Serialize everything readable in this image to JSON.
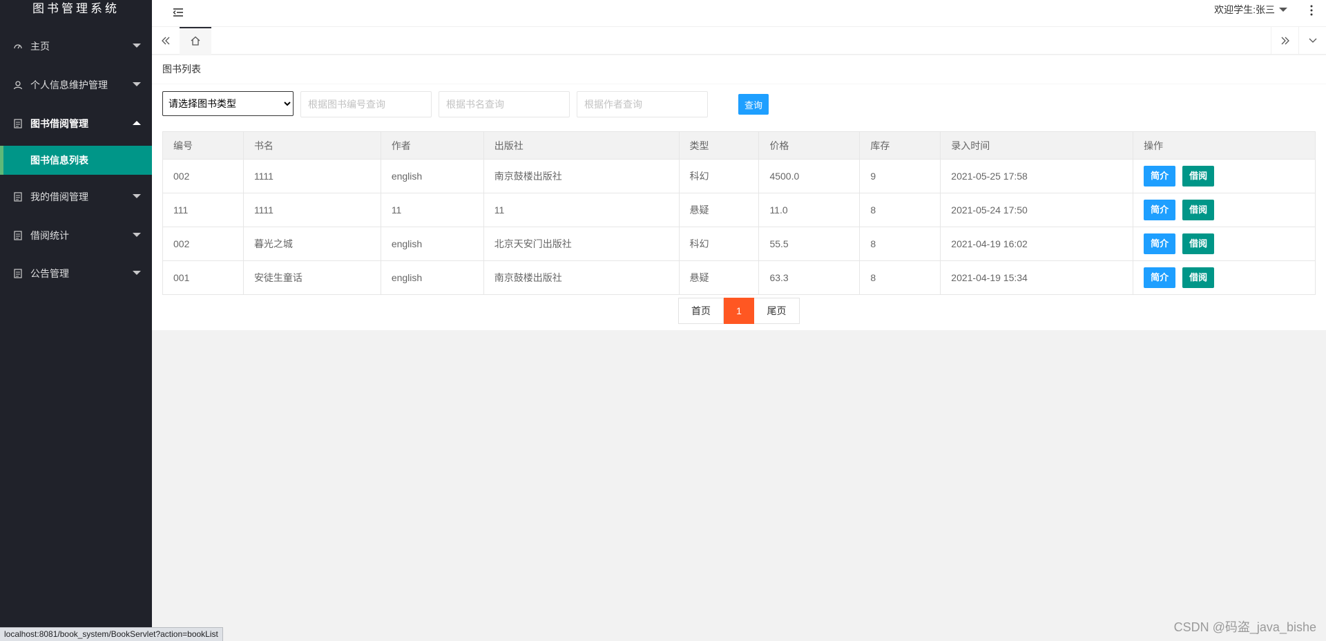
{
  "app": {
    "title": "图书管理系统"
  },
  "sidebar": {
    "items": [
      {
        "label": "主页",
        "icon": "dashboard-icon"
      },
      {
        "label": "个人信息维护管理",
        "icon": "user-icon"
      },
      {
        "label": "图书借阅管理",
        "icon": "document-icon",
        "expanded": true
      },
      {
        "label": "我的借阅管理",
        "icon": "document-icon"
      },
      {
        "label": "借阅统计",
        "icon": "document-icon"
      },
      {
        "label": "公告管理",
        "icon": "document-icon"
      }
    ],
    "subitem": {
      "label": "图书信息列表"
    }
  },
  "header": {
    "user": "欢迎学生:张三"
  },
  "card": {
    "title": "图书列表"
  },
  "filters": {
    "type_select": "请选择图书类型",
    "id_placeholder": "根据图书编号查询",
    "name_placeholder": "根据书名查询",
    "author_placeholder": "根据作者查询",
    "query_label": "查询"
  },
  "table": {
    "columns": [
      "编号",
      "书名",
      "作者",
      "出版社",
      "类型",
      "价格",
      "库存",
      "录入时间",
      "操作"
    ],
    "rows": [
      {
        "id": "002",
        "name": "1111",
        "author": "english",
        "publisher": "南京鼓楼出版社",
        "type": "科幻",
        "price": "4500.0",
        "stock": "9",
        "time": "2021-05-25 17:58"
      },
      {
        "id": "111",
        "name": "1111",
        "author": "11",
        "publisher": "11",
        "type": "悬疑",
        "price": "11.0",
        "stock": "8",
        "time": "2021-05-24 17:50"
      },
      {
        "id": "002",
        "name": "暮光之城",
        "author": "english",
        "publisher": "北京天安门出版社",
        "type": "科幻",
        "price": "55.5",
        "stock": "8",
        "time": "2021-04-19 16:02"
      },
      {
        "id": "001",
        "name": "安徒生童话",
        "author": "english",
        "publisher": "南京鼓楼出版社",
        "type": "悬疑",
        "price": "63.3",
        "stock": "8",
        "time": "2021-04-19 15:34"
      }
    ],
    "intro_label": "简介",
    "borrow_label": "借阅"
  },
  "pager": {
    "first": "首页",
    "current": "1",
    "last": "尾页"
  },
  "statusbar": {
    "url": "localhost:8081/book_system/BookServlet?action=bookList"
  },
  "watermark": "CSDN @码盗_java_bishe",
  "colors": {
    "sidebar": "#20222a",
    "active": "#009688",
    "primary": "#1e9fff",
    "pager_current": "#ff5722"
  }
}
